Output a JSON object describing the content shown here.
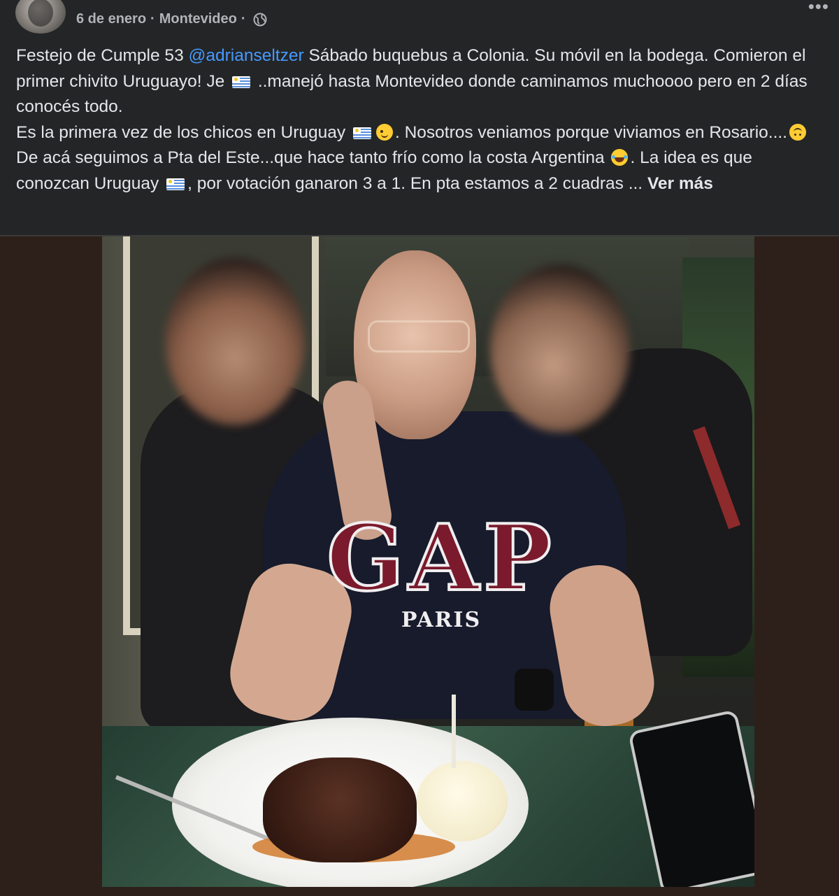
{
  "post": {
    "meta": {
      "date": "6 de enero",
      "separator": "·",
      "place": "Montevideo",
      "separator2": "·",
      "privacy_icon": "globe-icon",
      "more_icon": "more-options-icon"
    },
    "text": {
      "line1_a": "Festejo de Cumple 53 ",
      "mention": "@adrianseltzer",
      "line1_b": " Sábado buquebus a Colonia. Su móvil en la bodega. Comieron el primer chivito Uruguayo! Je ",
      "line2_b": " ..manejó hasta Montevideo donde caminamos muchoooo pero en 2 días conocés todo.",
      "line3_a": " Es la primera vez de los chicos en Uruguay ",
      "line3_b": ". Nosotros veniamos porque viviamos en Rosario....",
      "line4_b": "De acá seguimos a Pta del Este...que hace tanto frío como la costa Argentina ",
      "line4_c": ". La idea es que conozcan Uruguay ",
      "line5_b": ", por votación ganaron 3 a 1. En pta estamos a 2 cuadras ... ",
      "see_more": "Ver más"
    },
    "emojis": [
      "uruguay-flag-icon",
      "winking-face-icon",
      "upside-down-face-icon",
      "tears-of-joy-icon"
    ],
    "photo": {
      "shirt_logo": "GAP",
      "shirt_subtext": "PARIS"
    }
  },
  "colors": {
    "background": "#242526",
    "text": "#e4e6eb",
    "secondary_text": "#b0b3b8",
    "mention": "#4599ff",
    "photo_frame": "#2d201a"
  }
}
